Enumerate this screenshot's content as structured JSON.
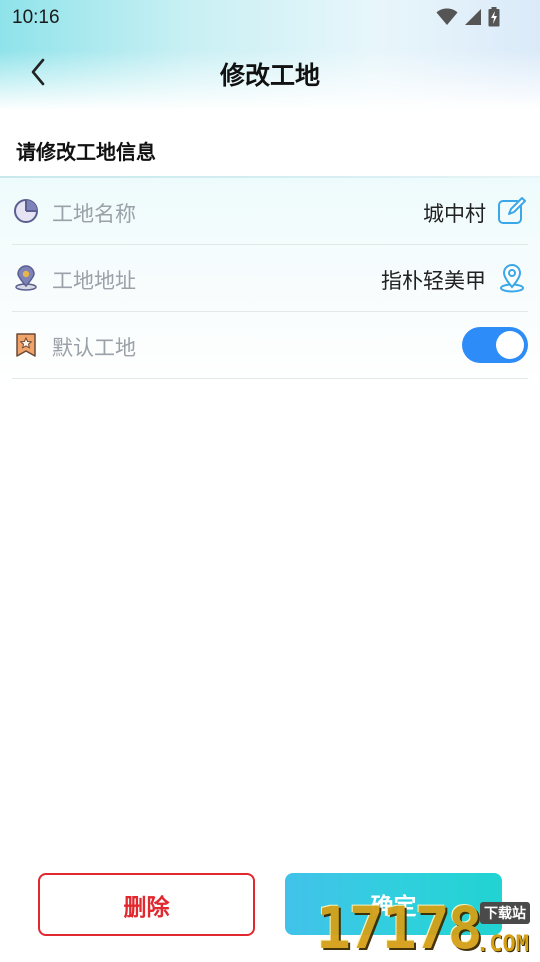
{
  "status_bar": {
    "time": "10:16"
  },
  "header": {
    "title": "修改工地"
  },
  "form": {
    "heading": "请修改工地信息",
    "rows": [
      {
        "label": "工地名称",
        "value": "城中村",
        "icon": "pie-chart-icon",
        "action_icon": "edit-icon"
      },
      {
        "label": "工地地址",
        "value": "指朴轻美甲",
        "icon": "map-pin-icon",
        "action_icon": "location-icon"
      },
      {
        "label": "默认工地",
        "icon": "bookmark-star-icon",
        "toggle_on": true
      }
    ]
  },
  "actions": {
    "delete_label": "删除",
    "confirm_label": "确定"
  },
  "watermark": {
    "digits": "17178",
    "suffix": ".COM",
    "tag": "下载站"
  },
  "colors": {
    "accent_blue": "#2d8cf7",
    "danger_red": "#e0282e",
    "confirm_gradient_start": "#42c2ea",
    "confirm_gradient_end": "#21d3d2",
    "label_gray": "#9aa1a8"
  }
}
